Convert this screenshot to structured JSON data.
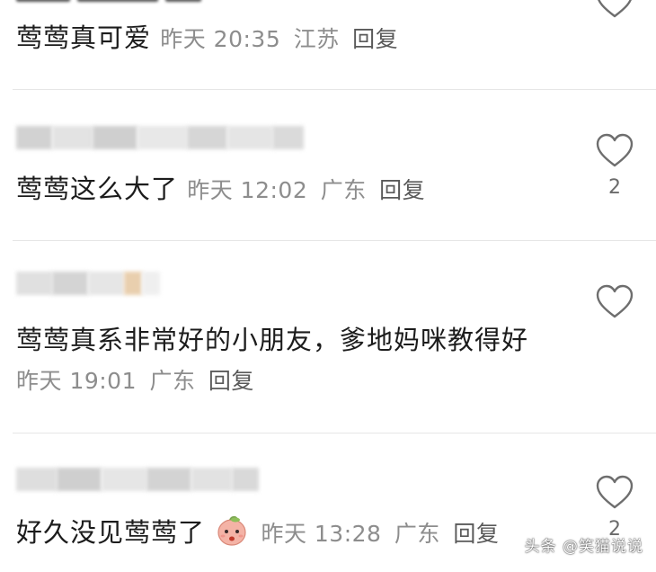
{
  "comments": [
    {
      "text": "莺莺真可爱",
      "time": "昨天 20:35",
      "location": "江苏",
      "reply_label": "回复",
      "like_count": ""
    },
    {
      "text": "莺莺这么大了",
      "time": "昨天 12:02",
      "location": "广东",
      "reply_label": "回复",
      "like_count": "2"
    },
    {
      "text": "莺莺真系非常好的小朋友，爹地妈咪教得好",
      "time": "昨天 19:01",
      "location": "广东",
      "reply_label": "回复",
      "like_count": ""
    },
    {
      "text": "好久没见莺莺了",
      "time": "昨天 13:28",
      "location": "广东",
      "reply_label": "回复",
      "like_count": "2"
    }
  ],
  "icons": {
    "like": "heart-outline-icon",
    "emoji": "peach-face-emoji"
  },
  "watermark": "头条 @笑猫说说",
  "colors": {
    "meta_text": "#8d8d8d",
    "divider": "#e6e6e6",
    "heart_stroke": "#6e6e6e"
  }
}
